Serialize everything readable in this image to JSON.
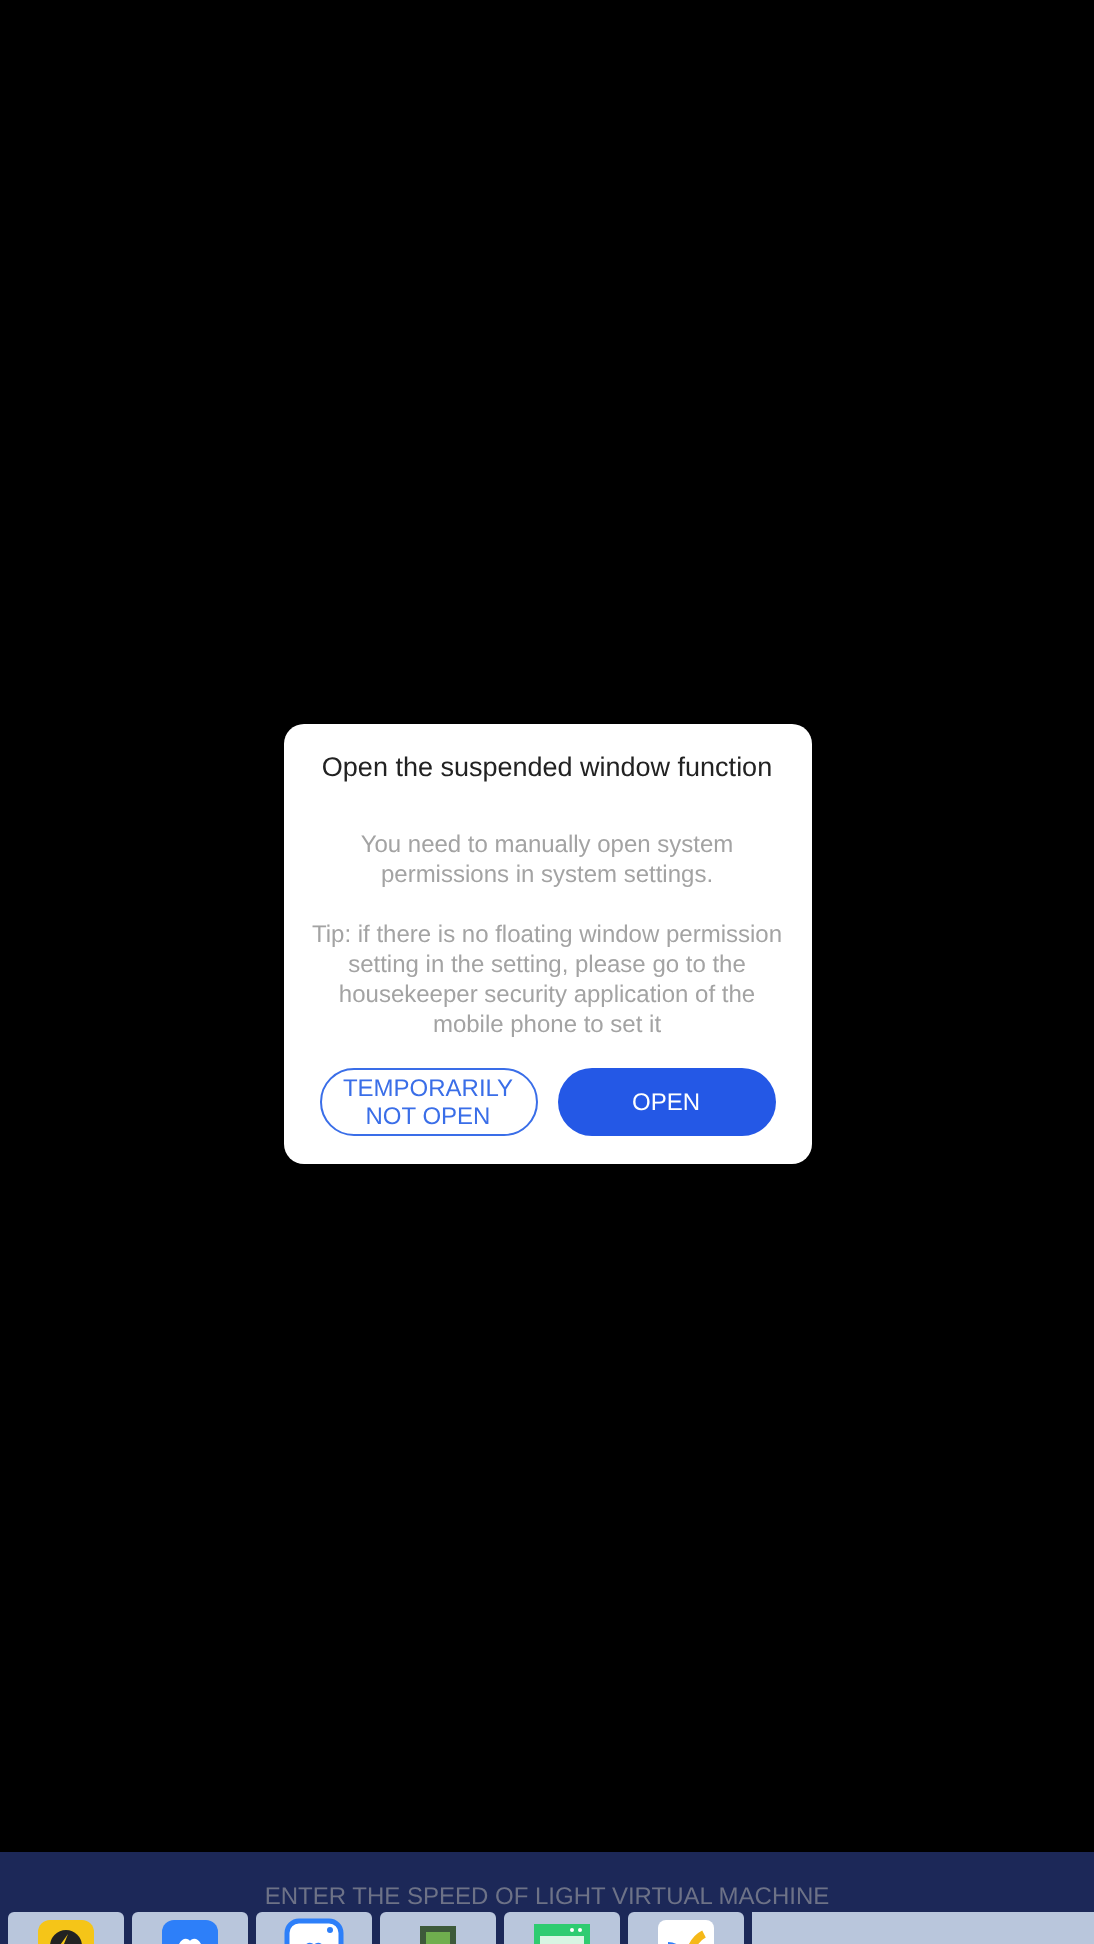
{
  "dialog": {
    "title": "Open the suspended window function",
    "message": "You need to manually open system permissions in system settings.",
    "tip": "Tip: if there is no floating window permission setting in the setting, please go to the housekeeper security application of the mobile phone to set it",
    "buttons": [
      {
        "label": "TEMPORARILY NOT OPEN",
        "kind": "outline"
      },
      {
        "label": "OPEN",
        "kind": "primary"
      }
    ]
  },
  "bottom_bar": {
    "caption": "ENTER THE SPEED OF LIGHT VIRTUAL MACHINE"
  }
}
